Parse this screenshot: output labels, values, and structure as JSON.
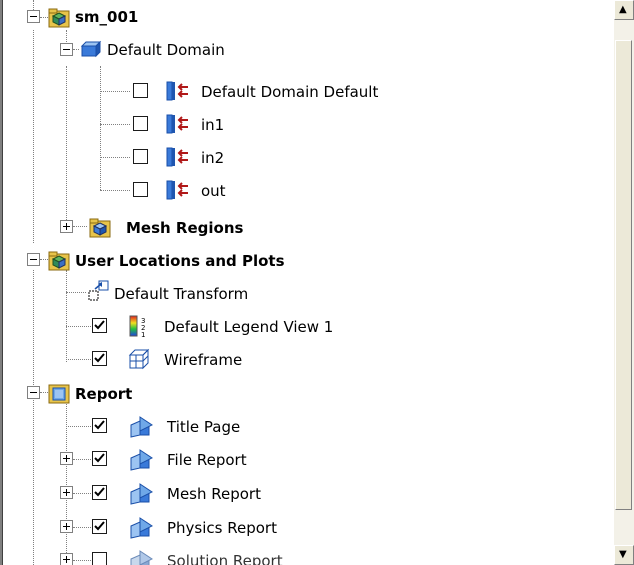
{
  "tree": {
    "items": [
      {
        "label": "sm_001",
        "bold": true
      },
      {
        "label": "Default Domain",
        "bold": false
      },
      {
        "label": "Default Domain Default",
        "checked": false
      },
      {
        "label": "in1",
        "checked": false
      },
      {
        "label": "in2",
        "checked": false
      },
      {
        "label": "out",
        "checked": false
      },
      {
        "label": "Mesh Regions",
        "bold": true
      },
      {
        "label": "User Locations and Plots",
        "bold": true
      },
      {
        "label": "Default Transform"
      },
      {
        "label": "Default Legend View 1",
        "checked": true
      },
      {
        "label": "Wireframe",
        "checked": true
      },
      {
        "label": "Report",
        "bold": true
      },
      {
        "label": "Title Page",
        "checked": true
      },
      {
        "label": "File Report",
        "checked": true
      },
      {
        "label": "Mesh Report",
        "checked": true
      },
      {
        "label": "Physics Report",
        "checked": true
      },
      {
        "label": "Solution Report",
        "checked": false
      }
    ]
  },
  "icons": {
    "case": "case-folder-icon",
    "domain": "domain-cube-icon",
    "boundary": "boundary-icon",
    "mesh": "mesh-regions-icon",
    "locations": "user-locations-icon",
    "transform": "transform-icon",
    "legend": "legend-icon",
    "wireframe": "wireframe-icon",
    "report": "report-icon",
    "report_section": "report-section-icon"
  },
  "colors": {
    "folder": "#e8c44a",
    "cube": "#3a7ad9",
    "boundary_arrow": "#b01818",
    "check": "#000000"
  }
}
